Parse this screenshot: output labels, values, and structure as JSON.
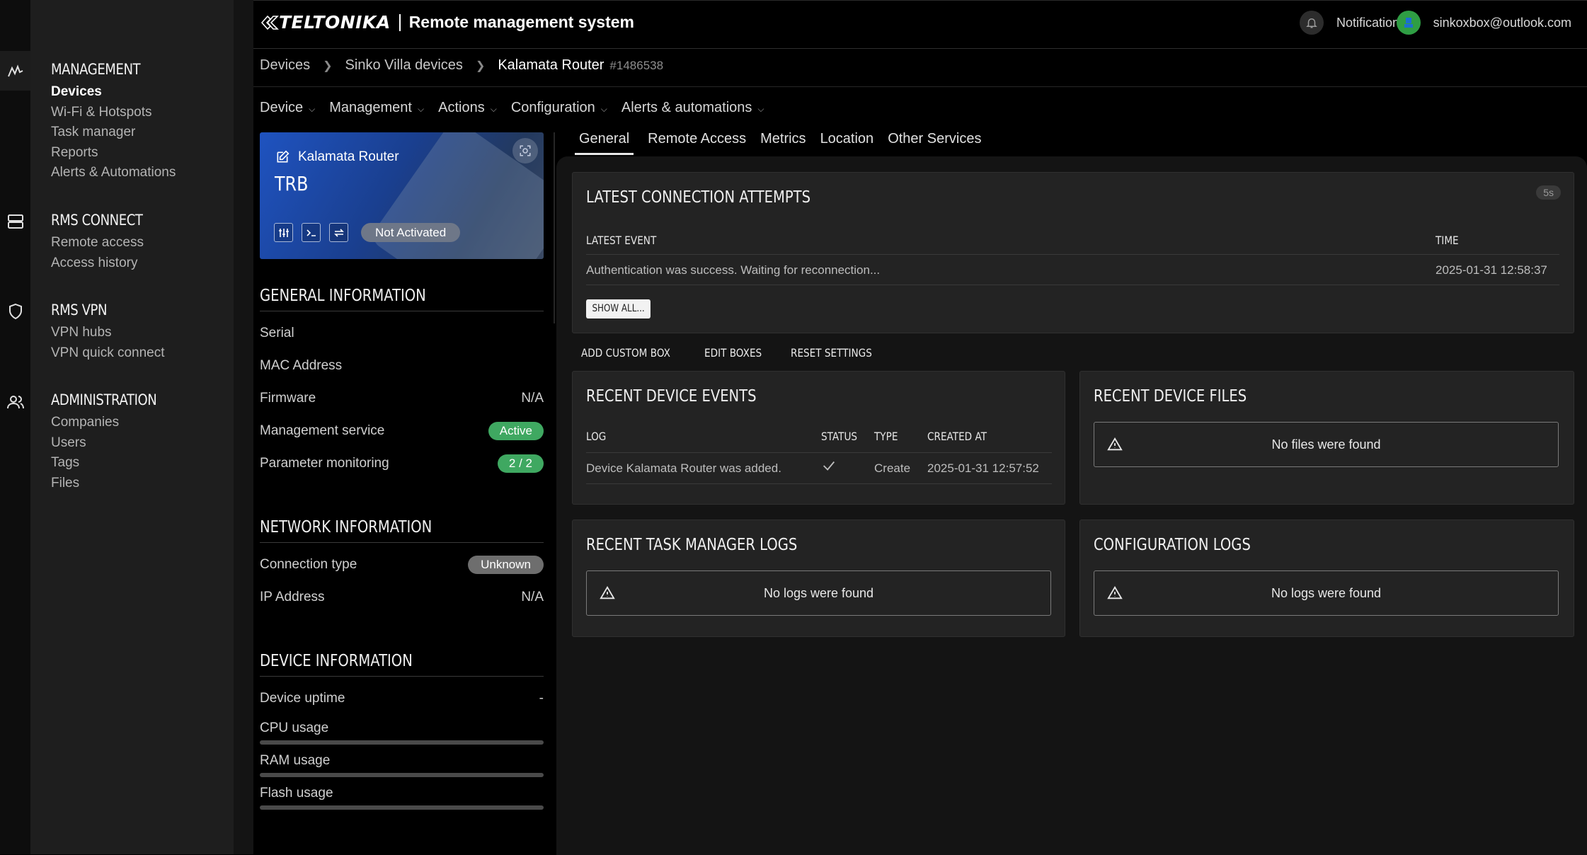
{
  "header": {
    "logo_text": "TELTONIKA",
    "app_title": "Remote management system",
    "notifications_label": "Notifications",
    "user_email": "sinkoxbox@outlook.com"
  },
  "sidebar": {
    "sections": [
      {
        "title": "MANAGEMENT",
        "items": [
          "Devices",
          "Wi-Fi & Hotspots",
          "Task manager",
          "Reports",
          "Alerts & Automations"
        ]
      },
      {
        "title": "RMS CONNECT",
        "items": [
          "Remote access",
          "Access history"
        ]
      },
      {
        "title": "RMS VPN",
        "items": [
          "VPN hubs",
          "VPN quick connect"
        ]
      },
      {
        "title": "ADMINISTRATION",
        "items": [
          "Companies",
          "Users",
          "Tags",
          "Files"
        ]
      }
    ],
    "active_item": "Devices"
  },
  "breadcrumb": {
    "items": [
      "Devices",
      "Sinko Villa devices",
      "Kalamata Router"
    ],
    "device_id": "#1486538"
  },
  "menubar": [
    "Device",
    "Management",
    "Actions",
    "Configuration",
    "Alerts & automations"
  ],
  "device_card": {
    "name": "Kalamata Router",
    "model": "TRB",
    "status": "Not Activated",
    "accent": "#1f53c0"
  },
  "general_info": {
    "title": "GENERAL INFORMATION",
    "serial_label": "Serial",
    "serial_value": "",
    "mac_label": "MAC Address",
    "mac_value": "",
    "firmware_label": "Firmware",
    "firmware_value": "N/A",
    "mgmt_label": "Management service",
    "mgmt_value": "Active",
    "param_label": "Parameter monitoring",
    "param_value": "2 / 2"
  },
  "network_info": {
    "title": "NETWORK INFORMATION",
    "conn_label": "Connection type",
    "conn_value": "Unknown",
    "ip_label": "IP Address",
    "ip_value": "N/A"
  },
  "device_info": {
    "title": "DEVICE INFORMATION",
    "uptime_label": "Device uptime",
    "uptime_value": "-",
    "cpu_label": "CPU usage",
    "cpu_value": 0,
    "ram_label": "RAM usage",
    "ram_value": 0,
    "flash_label": "Flash usage",
    "flash_value": 0
  },
  "tabs": [
    "General",
    "Remote Access",
    "Metrics",
    "Location",
    "Other Services"
  ],
  "active_tab": "General",
  "connection_attempts": {
    "title": "LATEST CONNECTION ATTEMPTS",
    "refresh": "5s",
    "col_event": "LATEST EVENT",
    "col_time": "TIME",
    "event": "Authentication was success. Waiting for reconnection...",
    "time": "2025-01-31 12:58:37",
    "show_all": "SHOW ALL..."
  },
  "custom_actions": [
    "ADD CUSTOM BOX",
    "EDIT BOXES",
    "RESET SETTINGS"
  ],
  "device_events": {
    "title": "RECENT DEVICE EVENTS",
    "col_log": "LOG",
    "col_status": "STATUS",
    "col_type": "TYPE",
    "col_created": "CREATED AT",
    "row_log": "Device Kalamata Router was added.",
    "row_type": "Create",
    "row_created": "2025-01-31 12:57:52"
  },
  "device_files": {
    "title": "RECENT DEVICE FILES",
    "empty": "No files were found"
  },
  "task_logs": {
    "title": "RECENT TASK MANAGER LOGS",
    "empty": "No logs were found"
  },
  "config_logs": {
    "title": "CONFIGURATION LOGS",
    "empty": "No logs were found"
  }
}
